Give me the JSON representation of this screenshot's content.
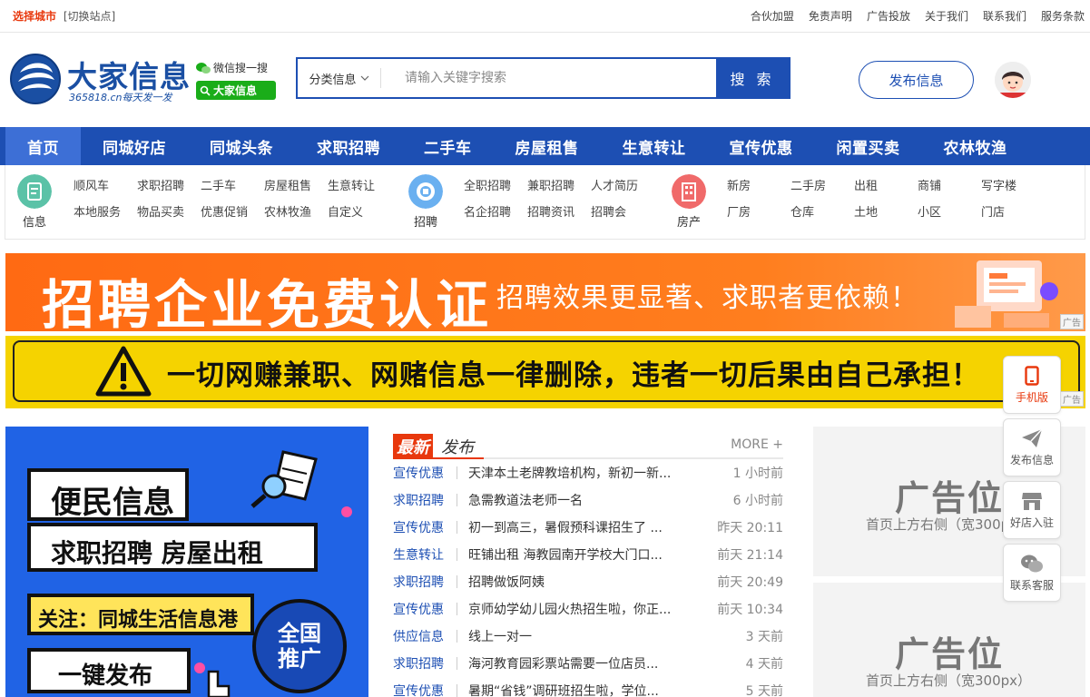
{
  "topbar": {
    "city": "选择城市",
    "switch": "[切换站点]",
    "links": [
      "合伙加盟",
      "免责声明",
      "广告投放",
      "关于我们",
      "联系我们",
      "服务条款"
    ]
  },
  "logo": {
    "name": "大家信息",
    "sub": "365818.cn每天发一发"
  },
  "wechat": {
    "text": "微信搜一搜",
    "badge": "大家信息"
  },
  "search": {
    "category": "分类信息",
    "placeholder": "请输入关键字搜索",
    "button": "搜 索"
  },
  "header": {
    "publish": "发布信息"
  },
  "nav": {
    "items": [
      "首页",
      "同城好店",
      "同城头条",
      "求职招聘",
      "二手车",
      "房屋租售",
      "生意转让",
      "宣传优惠",
      "闲置买卖",
      "农林牧渔"
    ]
  },
  "categories": {
    "info": {
      "label": "信息",
      "links": [
        "顺风车",
        "求职招聘",
        "二手车",
        "房屋租售",
        "生意转让",
        "本地服务",
        "物品买卖",
        "优惠促销",
        "农林牧渔",
        "自定义"
      ]
    },
    "jobs": {
      "label": "招聘",
      "links": [
        "全职招聘",
        "兼职招聘",
        "人才简历",
        "名企招聘",
        "招聘资讯",
        "招聘会"
      ]
    },
    "house": {
      "label": "房产",
      "links": [
        "新房",
        "二手房",
        "出租",
        "商铺",
        "写字楼",
        "厂房",
        "仓库",
        "土地",
        "小区",
        "门店"
      ]
    }
  },
  "banner1": {
    "big": "招聘企业免费认证",
    "small": "招聘效果更显著、求职者更依赖！",
    "ad": "广告"
  },
  "banner2": {
    "text": "一切网赚兼职、网赌信息一律删除，违者一切后果由自己承担！",
    "ad": "广告"
  },
  "promo": {
    "line1": "便民信息",
    "line2": "求职招聘 房屋出租",
    "line3": "关注：同城生活信息港",
    "line4": "一键发布",
    "badge": "全国推广"
  },
  "news": {
    "tag1": "最新",
    "tag2": "发布",
    "more": "MORE +",
    "rows": [
      {
        "cat": "宣传优惠",
        "title": "天津本土老牌教培机构，新初一新...",
        "time": "1 小时前"
      },
      {
        "cat": "求职招聘",
        "title": "急需教道法老师一名",
        "time": "6 小时前"
      },
      {
        "cat": "宣传优惠",
        "title": "初一到高三，暑假预科课招生了 ...",
        "time": "昨天 20:11"
      },
      {
        "cat": "生意转让",
        "title": "旺铺出租 海教园南开学校大门口...",
        "time": "前天 21:14"
      },
      {
        "cat": "求职招聘",
        "title": "招聘做饭阿姨",
        "time": "前天 20:49"
      },
      {
        "cat": "宣传优惠",
        "title": "京师幼学幼儿园火热招生啦，你正...",
        "time": "前天 10:34"
      },
      {
        "cat": "供应信息",
        "title": "线上一对一",
        "time": "3 天前"
      },
      {
        "cat": "求职招聘",
        "title": "海河教育园彩票站需要一位店员...",
        "time": "4 天前"
      },
      {
        "cat": "宣传优惠",
        "title": "暑期“省钱”调研班招生啦，学位...",
        "time": "5 天前"
      }
    ]
  },
  "ads": [
    {
      "big": "广告位",
      "small": "首页上方右侧（宽300px）"
    },
    {
      "big": "广告位",
      "small": "首页上方右侧（宽300px）"
    }
  ],
  "floatbar": {
    "items": [
      "手机版",
      "发布信息",
      "好店入驻",
      "联系客服"
    ]
  },
  "colors": {
    "brand_blue": "#1d4fb3",
    "accent_red": "#e8380d",
    "banner_orange": "#ff6a13",
    "banner_yellow": "#f5d300"
  }
}
